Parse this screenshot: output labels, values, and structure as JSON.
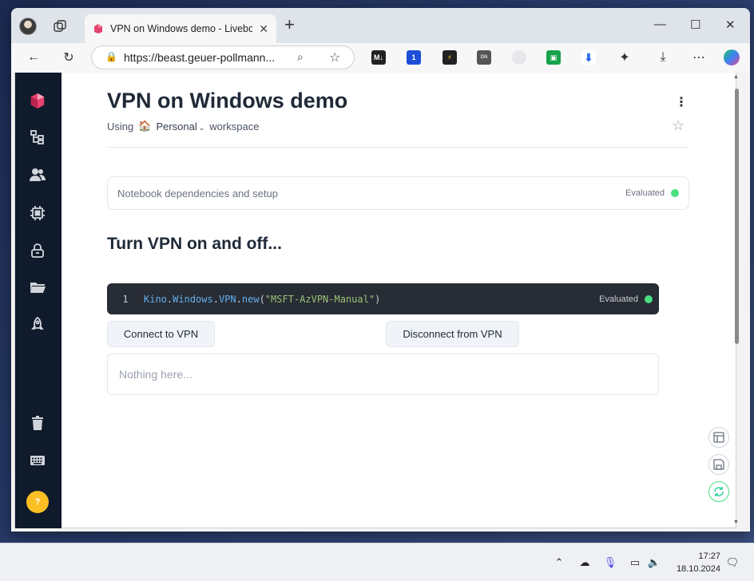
{
  "browser": {
    "tab_title": "VPN on Windows demo - Livebook",
    "url": "https://beast.geuer-pollmann...",
    "new_tab": "+",
    "extensions": [
      "M↓",
      "1",
      "⚡",
      "DN",
      "",
      "",
      "",
      "puzzle"
    ]
  },
  "notebook": {
    "title": "VPN on Windows demo",
    "using_label": "Using",
    "workspace_emoji": "🏠",
    "workspace_name": "Personal",
    "workspace_suffix": "workspace",
    "setup_section": "Notebook dependencies and setup",
    "status_evaluated": "Evaluated",
    "section_heading": "Turn VPN on and off...",
    "code_line_number": "1",
    "code": {
      "module1": "Kino",
      "dot1": ".",
      "module2": "Windows",
      "dot2": ".",
      "module3": "VPN",
      "dot3": ".",
      "fn": "new",
      "open": "(",
      "arg": "\"MSFT-AzVPN-Manual\"",
      "close": ")"
    },
    "buttons": {
      "connect": "Connect to VPN",
      "disconnect": "Disconnect from VPN"
    },
    "output_placeholder": "Nothing here..."
  },
  "sidebar": {
    "help_label": "?",
    "icons": [
      "livebook-logo-icon",
      "tree-icon",
      "users-icon",
      "chip-icon",
      "lock-icon",
      "folder-icon",
      "rocket-icon",
      "trash-icon",
      "keyboard-icon"
    ]
  },
  "taskbar": {
    "time": "17:27",
    "date": "18.10.2024"
  },
  "colors": {
    "evaluated_dot": "#4ade80",
    "sidebar_bg": "#0f1a2b",
    "help_badge": "#fbbf24"
  }
}
